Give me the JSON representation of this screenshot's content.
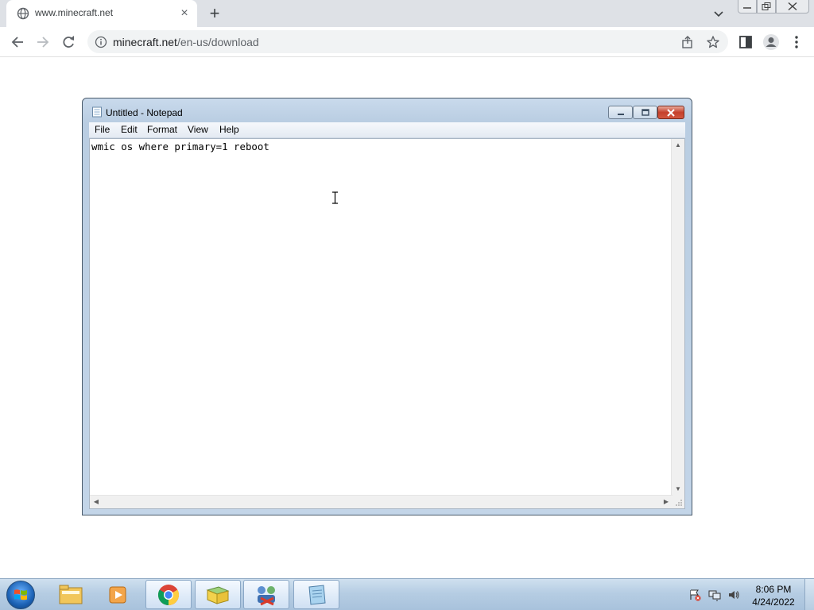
{
  "browser": {
    "tab": {
      "title": "www.minecraft.net",
      "close_glyph": "×"
    },
    "new_tab_glyph": "+",
    "url": {
      "host": "minecraft.net",
      "path": "/en-us/download"
    },
    "icons": [
      "globe-icon",
      "back-icon",
      "forward-icon",
      "reload-icon",
      "info-icon",
      "share-icon",
      "star-icon",
      "side-panel-icon",
      "profile-icon",
      "menu-icon"
    ]
  },
  "notepad": {
    "title": "Untitled - Notepad",
    "menu": {
      "file": "File",
      "edit": "Edit",
      "format": "Format",
      "view": "View",
      "help": "Help"
    },
    "content": "wmic os where primary=1 reboot"
  },
  "taskbar": {
    "clock": {
      "time": "8:06 PM",
      "date": "4/24/2022"
    },
    "apps": [
      "windows-explorer",
      "media-player",
      "chrome",
      "folder-app",
      "network-app",
      "notepad"
    ]
  },
  "colors": {
    "chrome_tabstrip": "#dee1e6",
    "omnibox": "#f1f3f4",
    "notepad_frame": "#c3d5e8",
    "taskbar": "#b6cde3",
    "close_button": "#c5402b"
  }
}
